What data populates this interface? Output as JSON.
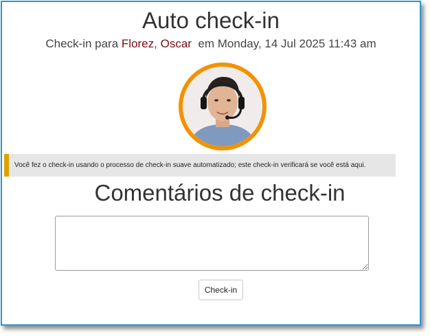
{
  "header": {
    "title": "Auto check-in",
    "subtitle_prefix": "Check-in para",
    "person_last": "Florez",
    "person_sep": ",",
    "person_first": "Oscar",
    "subtitle_suffix": "em Monday, 14 Jul 2025 11:43 am"
  },
  "avatar": {
    "icon": "user-photo-with-headset",
    "ring_color": "#f39200"
  },
  "notice": {
    "text": "Você fez o check-in usando o processo de check-in suave automatizado; este check-in verificará se você está aqui.",
    "accent_color": "#e0a100"
  },
  "comments": {
    "heading": "Comentários de check-in",
    "value": "",
    "placeholder": ""
  },
  "actions": {
    "checkin_label": "Check-in"
  }
}
